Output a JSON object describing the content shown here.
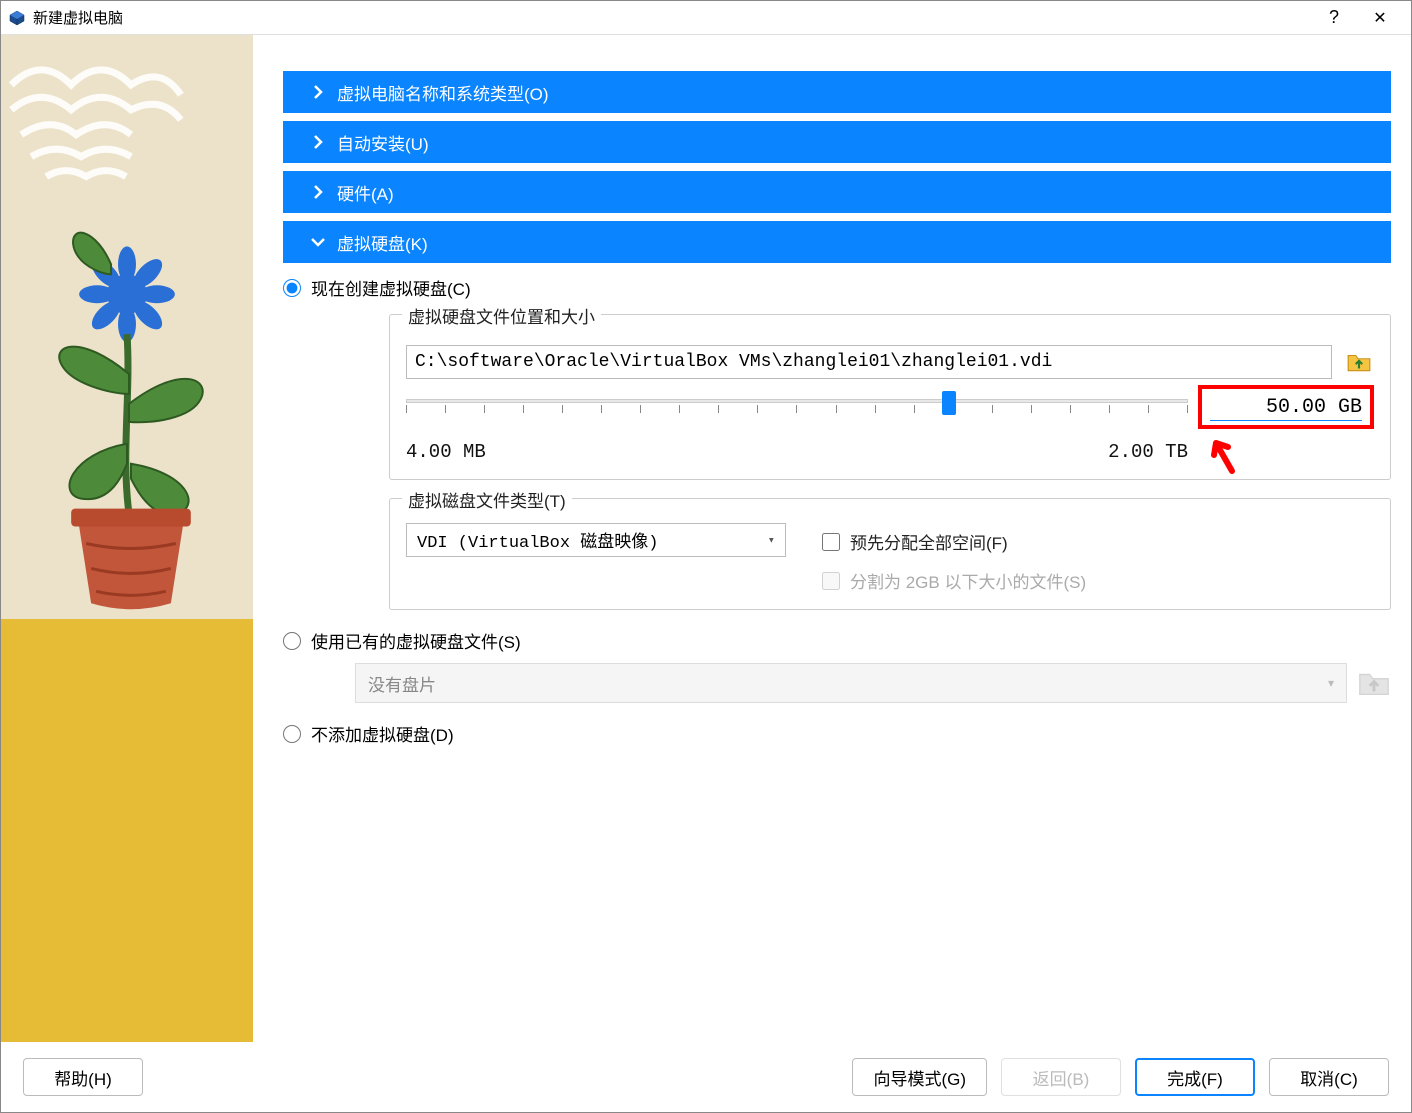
{
  "window": {
    "title": "新建虚拟电脑",
    "help_symbol": "?",
    "close_symbol": "✕"
  },
  "accordion": {
    "name_os": "虚拟电脑名称和系统类型(O)",
    "auto_install": "自动安装(U)",
    "hardware": "硬件(A)",
    "hard_disk": "虚拟硬盘(K)"
  },
  "disk_option": {
    "create_now": "现在创建虚拟硬盘(C)",
    "use_existing": "使用已有的虚拟硬盘文件(S)",
    "no_disk": "不添加虚拟硬盘(D)"
  },
  "group_location": {
    "legend": "虚拟硬盘文件位置和大小",
    "path": "C:\\software\\Oracle\\VirtualBox VMs\\zhanglei01\\zhanglei01.vdi",
    "size_value": "50.00 GB",
    "min_label": "4.00 MB",
    "max_label": "2.00 TB"
  },
  "group_type": {
    "legend": "虚拟磁盘文件类型(T)",
    "selected": "VDI (VirtualBox 磁盘映像)",
    "prealloc": "预先分配全部空间(F)",
    "split2g": "分割为 2GB 以下大小的文件(S)"
  },
  "existing_placeholder": "没有盘片",
  "footer": {
    "help": "帮助(H)",
    "wizard": "向导模式(G)",
    "back": "返回(B)",
    "finish": "完成(F)",
    "cancel": "取消(C)"
  }
}
